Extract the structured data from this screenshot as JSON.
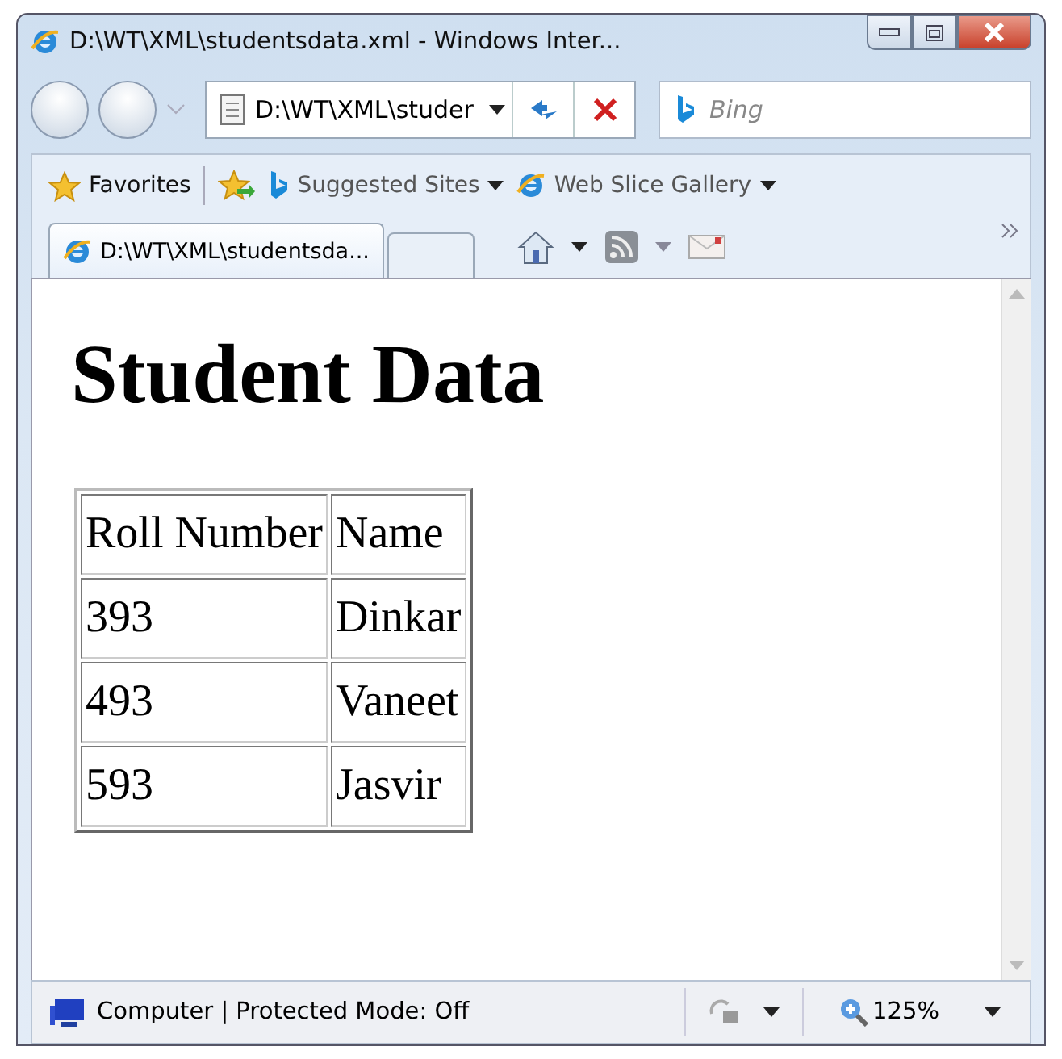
{
  "window": {
    "title": "D:\\WT\\XML\\studentsdata.xml - Windows Inter..."
  },
  "address_bar": {
    "value": "D:\\WT\\XML\\studer"
  },
  "search": {
    "placeholder": "Bing"
  },
  "favorites_bar": {
    "label": "Favorites",
    "links": [
      "Suggested Sites",
      "Web Slice Gallery"
    ]
  },
  "tabs": [
    {
      "label": "D:\\WT\\XML\\studentsda...",
      "selected": true
    }
  ],
  "page": {
    "heading": "Student Data",
    "table": {
      "columns": [
        "Roll Number",
        "Name"
      ],
      "rows": [
        [
          "393",
          "Dinkar"
        ],
        [
          "493",
          "Vaneet"
        ],
        [
          "593",
          "Jasvir"
        ]
      ]
    }
  },
  "status_bar": {
    "zone": "Computer | Protected Mode: Off",
    "zoom": "125%"
  }
}
